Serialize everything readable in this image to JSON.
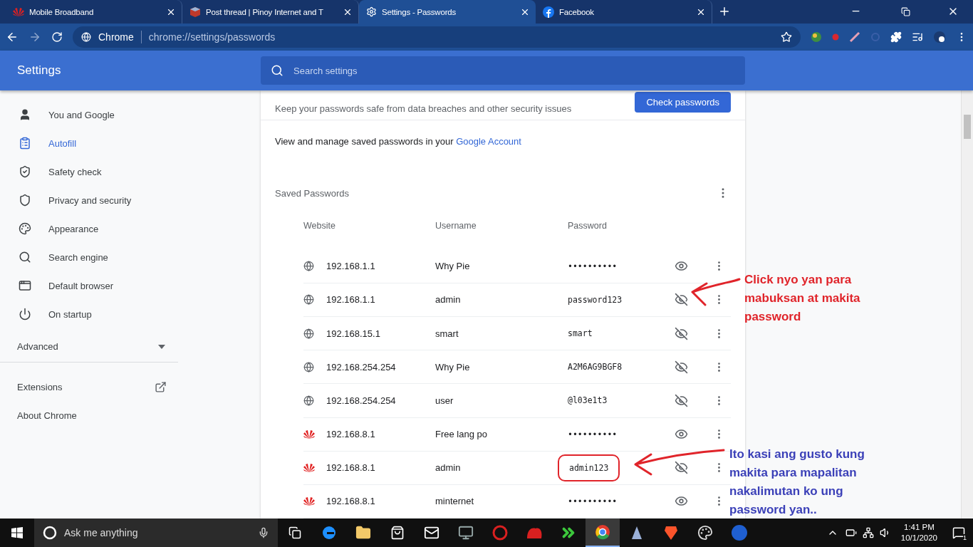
{
  "tabs": [
    {
      "title": "Mobile Broadband",
      "kind": "huawei",
      "selected": false
    },
    {
      "title": "Post thread | Pinoy Internet and T",
      "kind": "cube",
      "selected": false
    },
    {
      "title": "Settings - Passwords",
      "kind": "gear",
      "selected": true
    },
    {
      "title": "Facebook",
      "kind": "facebook",
      "selected": false
    }
  ],
  "omnibox": {
    "chip": "Chrome",
    "url": "chrome://settings/passwords"
  },
  "header": {
    "title": "Settings",
    "search_placeholder": "Search settings"
  },
  "sidebar": {
    "items": [
      {
        "label": "You and Google",
        "kind": "person",
        "selected": false
      },
      {
        "label": "Autofill",
        "kind": "autofill",
        "selected": true
      },
      {
        "label": "Safety check",
        "kind": "shield-check",
        "selected": false
      },
      {
        "label": "Privacy and security",
        "kind": "shield",
        "selected": false
      },
      {
        "label": "Appearance",
        "kind": "palette",
        "selected": false
      },
      {
        "label": "Search engine",
        "kind": "search",
        "selected": false
      },
      {
        "label": "Default browser",
        "kind": "browser",
        "selected": false
      },
      {
        "label": "On startup",
        "kind": "power",
        "selected": false
      }
    ],
    "advanced": {
      "label": "Advanced",
      "expanded": false
    },
    "links": [
      {
        "label": "Extensions",
        "external": true
      },
      {
        "label": "About Chrome",
        "external": false
      }
    ]
  },
  "check_section": {
    "description": "Keep your passwords safe from data breaches and other security issues",
    "button": "Check passwords"
  },
  "manage_text": "View and manage saved passwords in your",
  "manage_link": "Google Account",
  "saved_title": "Saved Passwords",
  "columns": [
    "Website",
    "Username",
    "Password"
  ],
  "rows": [
    {
      "site": "192.168.1.1",
      "kind": "globe",
      "username": "Why Pie",
      "password": "••••••••••",
      "revealed": false,
      "circled": false
    },
    {
      "site": "192.168.1.1",
      "kind": "globe",
      "username": "admin",
      "password": "password123",
      "revealed": true,
      "circled": false
    },
    {
      "site": "192.168.15.1",
      "kind": "globe",
      "username": "smart",
      "password": "smart",
      "revealed": true,
      "circled": false
    },
    {
      "site": "192.168.254.254",
      "kind": "globe",
      "username": "Why Pie",
      "password": "A2M6AG9BGF8",
      "revealed": true,
      "circled": false
    },
    {
      "site": "192.168.254.254",
      "kind": "globe",
      "username": "user",
      "password": "@l03e1t3",
      "revealed": true,
      "circled": false
    },
    {
      "site": "192.168.8.1",
      "kind": "huawei",
      "username": "Free lang po",
      "password": "••••••••••",
      "revealed": false,
      "circled": false
    },
    {
      "site": "192.168.8.1",
      "kind": "huawei",
      "username": "admin",
      "password": "admin123",
      "revealed": true,
      "circled": true
    },
    {
      "site": "192.168.8.1",
      "kind": "huawei",
      "username": "minternet",
      "password": "••••••••••",
      "revealed": false,
      "circled": false
    }
  ],
  "annotations": [
    {
      "text": "Click nyo yan para\nmabuksan at makita\npassword",
      "color": "#e0242a"
    },
    {
      "text": "Ito kasi ang gusto kung\nmakita para mapalitan\nnakalimutan ko ung\npassword yan..",
      "color": "#3b40b8"
    }
  ],
  "taskbar": {
    "search_placeholder": "Ask me anything",
    "time": "1:41 PM",
    "date": "10/1/2020",
    "notifications": "1"
  }
}
